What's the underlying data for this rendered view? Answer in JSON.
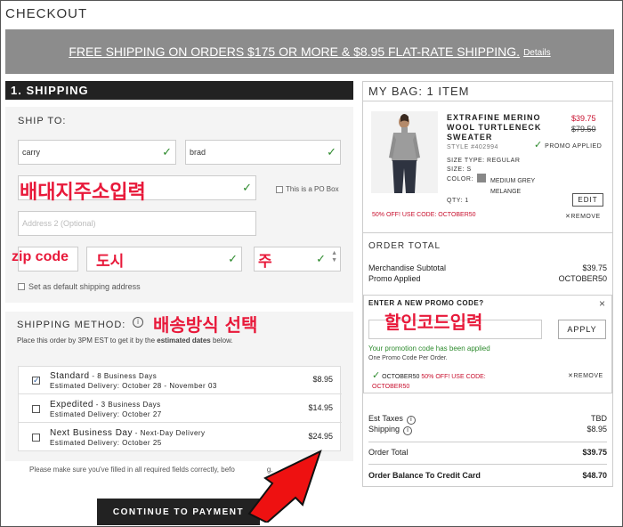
{
  "page": {
    "title": "CHECKOUT"
  },
  "banner": {
    "text": "FREE SHIPPING ON ORDERS $175 OR MORE & $8.95 FLAT-RATE SHIPPING.",
    "details": "Details"
  },
  "shipping": {
    "header": "1. SHIPPING",
    "ship_to_label": "SHIP TO:",
    "first_name": "carry",
    "last_name": "brad",
    "address2_placeholder": "Address 2 (Optional)",
    "po_box_label": "This is a PO Box",
    "default_label": "Set as default shipping address"
  },
  "annotations": {
    "address": "배대지주소입력",
    "zip": "zip code",
    "city": "도시",
    "state": "주",
    "method": "배송방식 선택",
    "promo": "할인코드입력"
  },
  "method": {
    "title": "SHIPPING METHOD:",
    "note_pre": "Place this order by 3PM EST to get it by the ",
    "note_bold": "estimated dates",
    "note_post": " below.",
    "options": [
      {
        "name": "Standard",
        "days": " - 8 Business Days",
        "delivery": "Estimated Delivery: October 28 - November 03",
        "price": "$8.95",
        "checked": "✓"
      },
      {
        "name": "Expedited",
        "days": " - 3 Business Days",
        "delivery": "Estimated Delivery: October 27",
        "price": "$14.95",
        "checked": ""
      },
      {
        "name": "Next Business Day",
        "days": " - Next-Day Delivery",
        "delivery": "Estimated Delivery: October 25",
        "price": "$24.95",
        "checked": ""
      }
    ],
    "fill_note": "Please make sure you've filled in all required fields correctly, befo",
    "fill_note_tail": "g.",
    "continue": "CONTINUE TO PAYMENT"
  },
  "bag": {
    "title": "MY BAG: 1 ITEM",
    "product": {
      "name": "EXTRAFINE MERINO WOOL TURTLENECK SWEATER",
      "style": "STYLE #402994",
      "price": "$39.75",
      "old_price": "$79.50",
      "promo_applied": "PROMO APPLIED",
      "size_type": "SIZE TYPE: REGULAR",
      "size": "SIZE: S",
      "color_label": "COLOR:",
      "color": "MEDIUM GREY MELANGE",
      "qty": "QTY: 1",
      "edit": "EDIT",
      "code_note": "50% OFF! USE CODE: OCTOBER50",
      "remove": "REMOVE"
    },
    "order_total": {
      "title": "ORDER TOTAL",
      "subtotal_label": "Merchandise Subtotal",
      "subtotal": "$39.75",
      "promo_label": "Promo Applied",
      "promo": "OCTOBER50"
    },
    "promo": {
      "head": "ENTER A NEW PROMO CODE?",
      "close": "×",
      "apply": "APPLY",
      "ok": "Your promotion code has been applied",
      "per_order": "One Promo Code Per Order.",
      "code": "OCTOBER50",
      "code_desc": " 50% OFF! USE CODE:",
      "code_desc2": "OCTOBER50",
      "remove": "REMOVE"
    },
    "summary": {
      "taxes_label": "Est Taxes",
      "taxes": "TBD",
      "shipping_label": "Shipping",
      "shipping": "$8.95",
      "total_label": "Order Total",
      "total": "$39.75",
      "balance_label": "Order Balance To Credit Card",
      "balance": "$48.70"
    }
  }
}
